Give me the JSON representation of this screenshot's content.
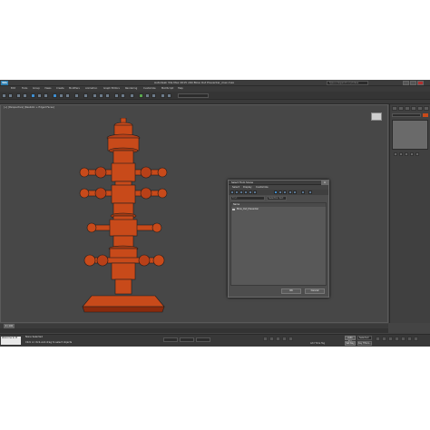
{
  "window": {
    "app_icon": "3ds",
    "title": "Autodesk 3ds Max 2015 x64     Blow Out Preventer_max.max",
    "search_placeholder": "Type a keyword or phrase"
  },
  "menubar": {
    "items": [
      "Edit",
      "Tools",
      "Group",
      "Views",
      "Create",
      "Modifiers",
      "Animation",
      "Graph Editors",
      "Rendering",
      "Customize",
      "MAXScript",
      "Help"
    ]
  },
  "viewport": {
    "label": "[+] [Perspective] [Realistic + Edged Faces]"
  },
  "dialog": {
    "title": "Select From Scene",
    "menu": [
      "Select",
      "Display",
      "Customize"
    ],
    "find_placeholder": "Find:",
    "selection_set": "Selection Set:",
    "list_header": "Name",
    "list_items": [
      "Blow_Out_Preventer"
    ],
    "ok_label": "OK",
    "cancel_label": "Cancel"
  },
  "timeline": {
    "frame": "0 / 100"
  },
  "status": {
    "maxscript": "Welcome to M",
    "none_selected": "None Selected",
    "prompt": "Click or click-and-drag to select objects",
    "auto_key": "Auto Key",
    "selected": "Selected",
    "set_key": "Set Key",
    "key_filters": "Key Filters...",
    "add_time_tag": "Add Time Tag"
  },
  "colors": {
    "model": "#c84a1a",
    "model_dark": "#8a2a0c",
    "panel": "#444444"
  }
}
